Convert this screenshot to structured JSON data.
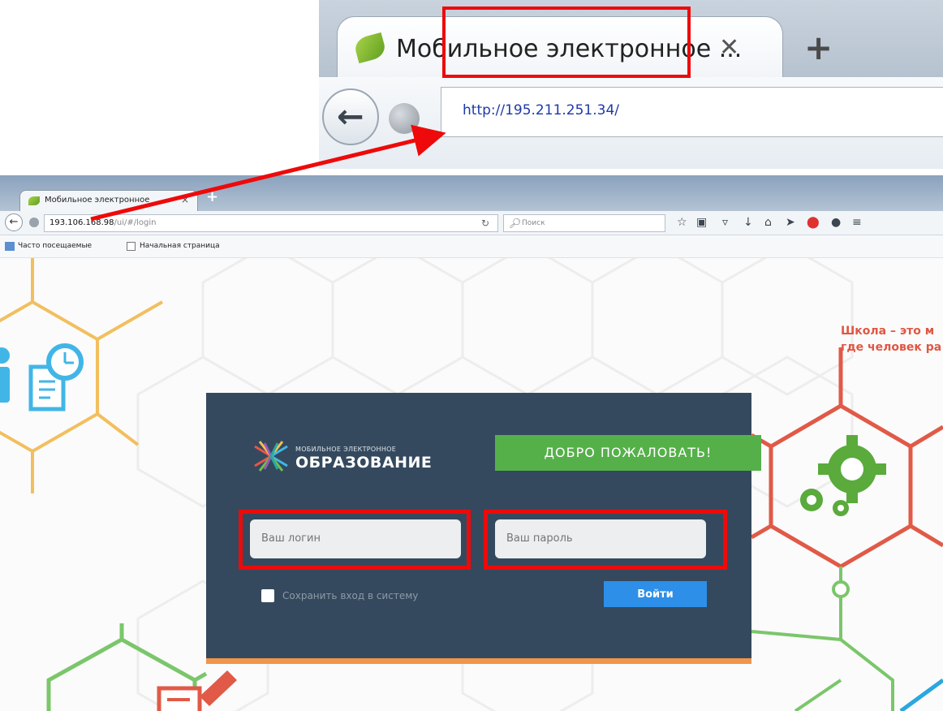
{
  "zoom_browser": {
    "tab_title": "Мобильное электронное ...",
    "close_symbol": "✕",
    "new_tab_symbol": "+",
    "url": "http://195.211.251.34/"
  },
  "small_browser": {
    "tab_title": "Мобильное электронное",
    "close_symbol": "×",
    "new_tab_symbol": "+",
    "url_host": "193.106.168.98",
    "url_path": "/ui/#/login",
    "search_placeholder": "Поиск",
    "bookmarks": [
      "Часто посещаемые",
      "Начальная страница"
    ]
  },
  "page": {
    "tagline_line1": "Школа – это м",
    "tagline_line2": "где человек ра",
    "logo_small": "МОБИЛЬНОЕ ЭЛЕКТРОННОЕ",
    "logo_big": "ОБРАЗОВАНИЕ",
    "welcome": "ДОБРО ПОЖАЛОВАТЬ!",
    "login_placeholder": "Ваш логин",
    "password_placeholder": "Ваш пароль",
    "remember_label": "Сохранить вход в систему",
    "enter_button": "Войти"
  },
  "colors": {
    "card": "#34495e",
    "welcome": "#56b04a",
    "button": "#2d8fe8",
    "highlight": "#ee0a0a",
    "card_border": "#f0954b"
  },
  "icons": {
    "toolbar": [
      "star-icon",
      "library-icon",
      "pocket-icon",
      "download-icon",
      "home-icon",
      "send-icon",
      "adblock-icon",
      "chat-icon",
      "menu-icon"
    ]
  }
}
